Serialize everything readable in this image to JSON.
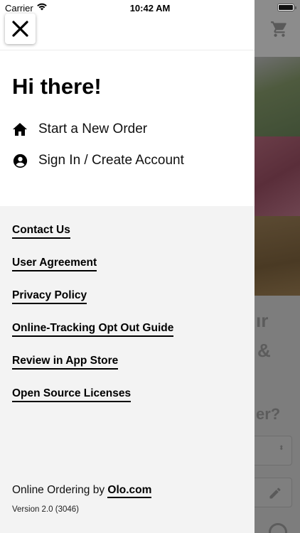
{
  "status_bar": {
    "carrier": "Carrier",
    "time": "10:42 AM"
  },
  "background": {
    "text_line1": "ır",
    "text_line2": "&",
    "text_line3": "er?",
    "select_arrows": "⬍"
  },
  "drawer": {
    "greeting": "Hi there!",
    "menu": [
      {
        "label": "Start a New Order",
        "icon": "home-icon"
      },
      {
        "label": "Sign In / Create Account",
        "icon": "account-circle-icon"
      }
    ],
    "links": [
      "Contact Us",
      "User Agreement",
      "Privacy Policy",
      "Online-Tracking Opt Out Guide",
      "Review in App Store",
      "Open Source Licenses"
    ],
    "footer": {
      "prefix": "Online Ordering by ",
      "brand": "Olo.com",
      "version": "Version 2.0 (3046)"
    }
  },
  "colors": {
    "drawer_bg": "#f3f3f3",
    "drawer_top_bg": "#ffffff",
    "overlay": "#7a7a7a",
    "text": "#000000"
  }
}
